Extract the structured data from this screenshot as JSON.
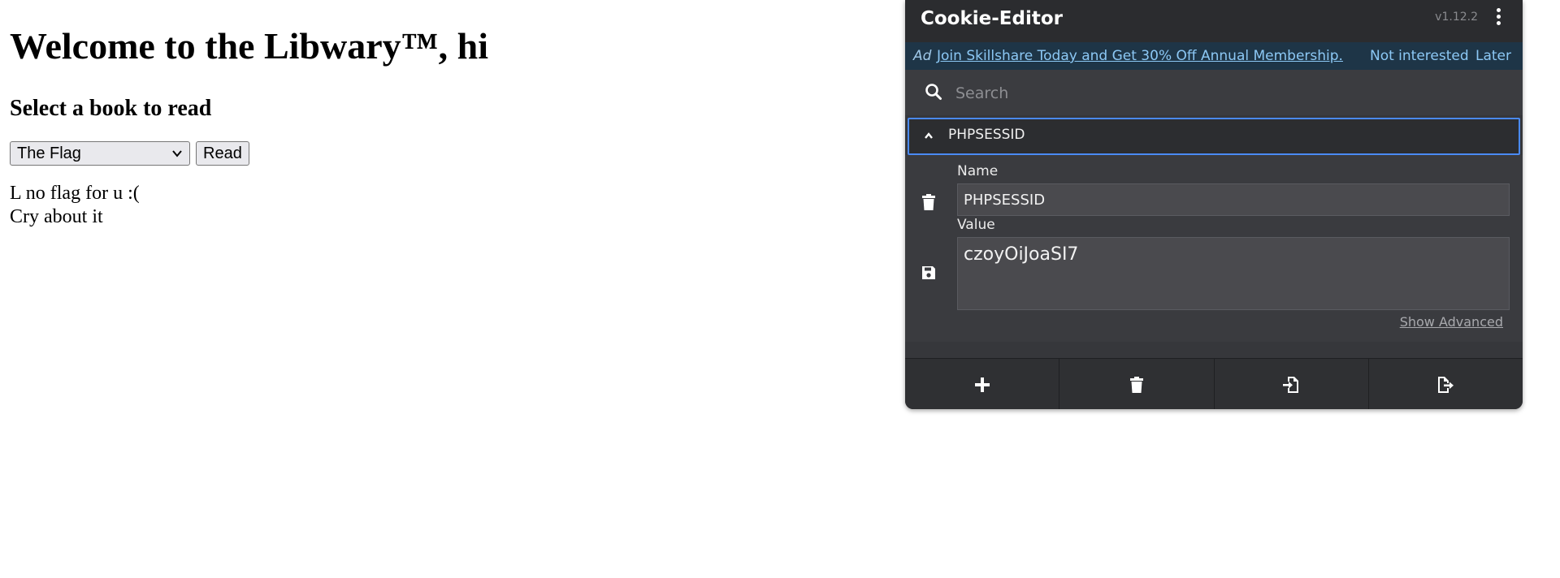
{
  "page": {
    "heading": "Welcome to the Libwary™, hi",
    "subheading": "Select a book to read",
    "book_select": {
      "selected": "The Flag"
    },
    "read_button": "Read",
    "message_line1": "L no flag for u :(",
    "message_line2": "Cry about it"
  },
  "cookie_editor": {
    "title": "Cookie-Editor",
    "version": "v1.12.2",
    "ad": {
      "tag": "Ad",
      "link_text": "Join Skillshare Today and Get 30% Off Annual Membership.",
      "not_interested": "Not interested",
      "later": "Later"
    },
    "search": {
      "placeholder": "Search",
      "value": ""
    },
    "cookie": {
      "name_header": "PHPSESSID",
      "name_label": "Name",
      "name_value": "PHPSESSID",
      "value_label": "Value",
      "value": "czoyOiJoaSI7",
      "advanced_link": "Show Advanced"
    },
    "footer_buttons": [
      "add-icon",
      "delete-all-icon",
      "import-icon",
      "export-icon"
    ]
  },
  "colors": {
    "panel_bg": "#36373b",
    "header_bg": "#2b2c2f",
    "ad_bg": "#1e3547",
    "ad_link": "#8cc8f5",
    "focus_border": "#4a8af4"
  }
}
